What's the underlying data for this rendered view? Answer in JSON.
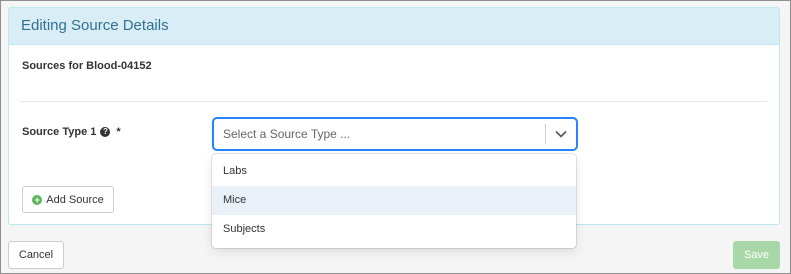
{
  "panel": {
    "title": "Editing Source Details",
    "subtitle": "Sources for Blood-04152"
  },
  "form": {
    "source_type_label": "Source Type 1",
    "help_icon": "question-circle-icon",
    "required_mark": "*",
    "select_placeholder": "Select a Source Type ...",
    "add_source_label": "Add Source"
  },
  "dropdown": {
    "options": [
      {
        "label": "Labs"
      },
      {
        "label": "Mice"
      },
      {
        "label": "Subjects"
      }
    ]
  },
  "footer": {
    "cancel_label": "Cancel",
    "save_label": "Save"
  },
  "colors": {
    "heading_bg": "#d9edf7",
    "heading_text": "#31708f",
    "focus_border": "#2684ff",
    "add_icon": "#5cb85c",
    "save_disabled": "#a8d8a8"
  }
}
